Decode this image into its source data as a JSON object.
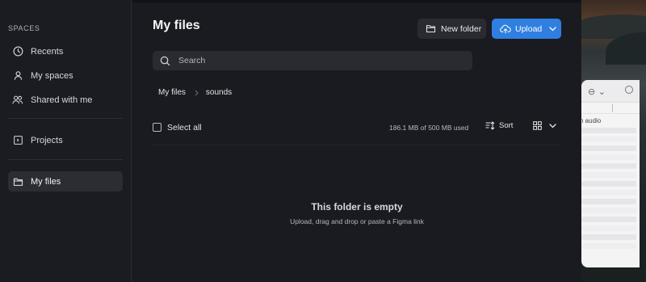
{
  "sidebar": {
    "section_label": "SPACES",
    "items": [
      {
        "label": "Recents",
        "icon": "clock-icon"
      },
      {
        "label": "My spaces",
        "icon": "person-icon"
      },
      {
        "label": "Shared with me",
        "icon": "people-icon"
      },
      {
        "label": "Projects",
        "icon": "project-icon"
      },
      {
        "label": "My files",
        "icon": "folder-icon"
      }
    ]
  },
  "header": {
    "title": "My files",
    "new_folder_label": "New folder",
    "upload_label": "Upload"
  },
  "search": {
    "placeholder": "Search"
  },
  "breadcrumb": {
    "items": [
      "My files",
      "sounds"
    ]
  },
  "toolbar": {
    "select_all_label": "Select all",
    "usage_text": "186.1 MB of 500 MB used",
    "sort_label": "Sort"
  },
  "empty_state": {
    "title": "This folder is empty",
    "subtitle": "Upload, drag and drop or paste a Figma link"
  },
  "background_window": {
    "partial_text": "n audio"
  },
  "colors": {
    "accent": "#2f7fe0",
    "sidebar_bg": "#1b1c21",
    "main_bg": "#1a1b20"
  }
}
